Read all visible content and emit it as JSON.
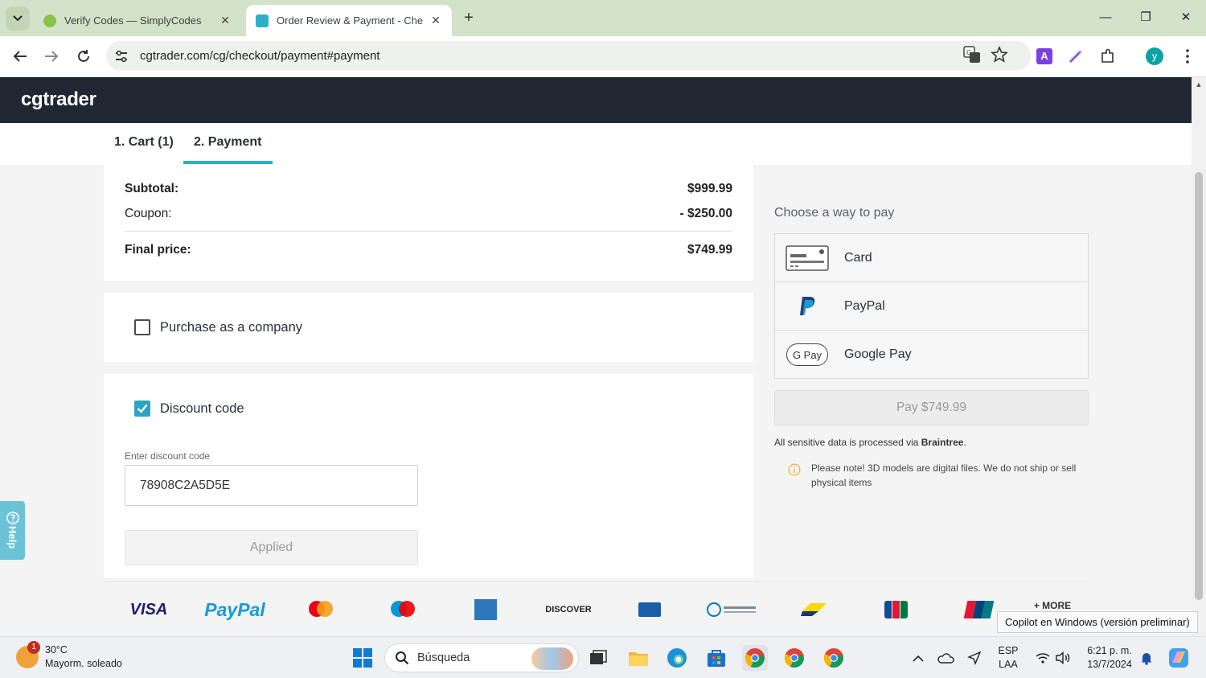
{
  "browser": {
    "tabs": [
      {
        "title": "Verify Codes — SimplyCodes",
        "active": false
      },
      {
        "title": "Order Review & Payment - Che",
        "active": true
      }
    ],
    "url": "cgtrader.com/cg/checkout/payment#payment",
    "profile_initial": "y"
  },
  "site": {
    "logo": "cgtrader",
    "steps": [
      "1. Cart (1)",
      "2. Payment"
    ],
    "active_step": 1
  },
  "summary": {
    "subtotal_label": "Subtotal:",
    "subtotal_value": "$999.99",
    "coupon_label": "Coupon:",
    "coupon_value": "- $250.00",
    "final_label": "Final price:",
    "final_value": "$749.99"
  },
  "company": {
    "label": "Purchase as a company",
    "checked": false
  },
  "discount": {
    "label": "Discount code",
    "checked": true,
    "field_label": "Enter discount code",
    "code": "78908C2A5D5E",
    "button": "Applied"
  },
  "payment": {
    "heading": "Choose a way to pay",
    "options": [
      {
        "label": "Card",
        "icon": "card-icon"
      },
      {
        "label": "PayPal",
        "icon": "paypal-icon"
      },
      {
        "label": "Google Pay",
        "icon": "google-pay-icon"
      }
    ],
    "gpay_badge": "G Pay",
    "pay_button": "Pay $749.99",
    "sensitive_prefix": "All sensitive data is processed via ",
    "sensitive_brand": "Braintree",
    "sensitive_suffix": ".",
    "note": "Please note! 3D models are digital files. We do not ship or sell physical items"
  },
  "payment_logos": {
    "visa": "VISA",
    "paypal": "PayPal",
    "discover": "DISCOVER",
    "more": "+ MORE"
  },
  "help": {
    "label": "Help"
  },
  "tooltip": "Copilot en Windows (versión preliminar)",
  "taskbar": {
    "weather_temp": "30°C",
    "weather_desc": "Mayorm. soleado",
    "weather_badge": "1",
    "search_placeholder": "Búsqueda",
    "lang_top": "ESP",
    "lang_bottom": "LAA",
    "time": "6:21 p. m.",
    "date": "13/7/2024"
  },
  "colors": {
    "header_bg": "#1f2733",
    "accent": "#2bb0c7",
    "tab_bar": "#d3e3c9"
  }
}
